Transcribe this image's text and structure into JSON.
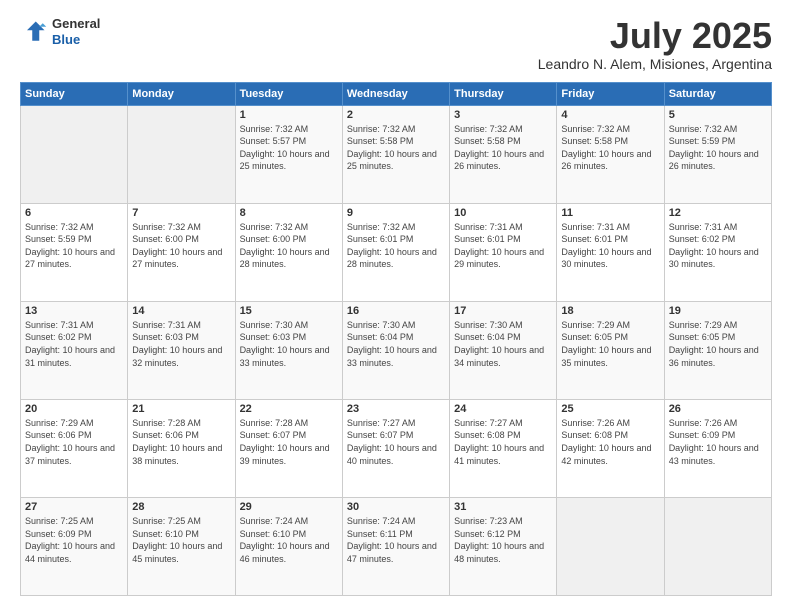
{
  "header": {
    "logo_line1": "General",
    "logo_line2": "Blue",
    "month": "July 2025",
    "location": "Leandro N. Alem, Misiones, Argentina"
  },
  "weekdays": [
    "Sunday",
    "Monday",
    "Tuesday",
    "Wednesday",
    "Thursday",
    "Friday",
    "Saturday"
  ],
  "weeks": [
    [
      {
        "day": "",
        "info": ""
      },
      {
        "day": "",
        "info": ""
      },
      {
        "day": "1",
        "info": "Sunrise: 7:32 AM\nSunset: 5:57 PM\nDaylight: 10 hours and 25 minutes."
      },
      {
        "day": "2",
        "info": "Sunrise: 7:32 AM\nSunset: 5:58 PM\nDaylight: 10 hours and 25 minutes."
      },
      {
        "day": "3",
        "info": "Sunrise: 7:32 AM\nSunset: 5:58 PM\nDaylight: 10 hours and 26 minutes."
      },
      {
        "day": "4",
        "info": "Sunrise: 7:32 AM\nSunset: 5:58 PM\nDaylight: 10 hours and 26 minutes."
      },
      {
        "day": "5",
        "info": "Sunrise: 7:32 AM\nSunset: 5:59 PM\nDaylight: 10 hours and 26 minutes."
      }
    ],
    [
      {
        "day": "6",
        "info": "Sunrise: 7:32 AM\nSunset: 5:59 PM\nDaylight: 10 hours and 27 minutes."
      },
      {
        "day": "7",
        "info": "Sunrise: 7:32 AM\nSunset: 6:00 PM\nDaylight: 10 hours and 27 minutes."
      },
      {
        "day": "8",
        "info": "Sunrise: 7:32 AM\nSunset: 6:00 PM\nDaylight: 10 hours and 28 minutes."
      },
      {
        "day": "9",
        "info": "Sunrise: 7:32 AM\nSunset: 6:01 PM\nDaylight: 10 hours and 28 minutes."
      },
      {
        "day": "10",
        "info": "Sunrise: 7:31 AM\nSunset: 6:01 PM\nDaylight: 10 hours and 29 minutes."
      },
      {
        "day": "11",
        "info": "Sunrise: 7:31 AM\nSunset: 6:01 PM\nDaylight: 10 hours and 30 minutes."
      },
      {
        "day": "12",
        "info": "Sunrise: 7:31 AM\nSunset: 6:02 PM\nDaylight: 10 hours and 30 minutes."
      }
    ],
    [
      {
        "day": "13",
        "info": "Sunrise: 7:31 AM\nSunset: 6:02 PM\nDaylight: 10 hours and 31 minutes."
      },
      {
        "day": "14",
        "info": "Sunrise: 7:31 AM\nSunset: 6:03 PM\nDaylight: 10 hours and 32 minutes."
      },
      {
        "day": "15",
        "info": "Sunrise: 7:30 AM\nSunset: 6:03 PM\nDaylight: 10 hours and 33 minutes."
      },
      {
        "day": "16",
        "info": "Sunrise: 7:30 AM\nSunset: 6:04 PM\nDaylight: 10 hours and 33 minutes."
      },
      {
        "day": "17",
        "info": "Sunrise: 7:30 AM\nSunset: 6:04 PM\nDaylight: 10 hours and 34 minutes."
      },
      {
        "day": "18",
        "info": "Sunrise: 7:29 AM\nSunset: 6:05 PM\nDaylight: 10 hours and 35 minutes."
      },
      {
        "day": "19",
        "info": "Sunrise: 7:29 AM\nSunset: 6:05 PM\nDaylight: 10 hours and 36 minutes."
      }
    ],
    [
      {
        "day": "20",
        "info": "Sunrise: 7:29 AM\nSunset: 6:06 PM\nDaylight: 10 hours and 37 minutes."
      },
      {
        "day": "21",
        "info": "Sunrise: 7:28 AM\nSunset: 6:06 PM\nDaylight: 10 hours and 38 minutes."
      },
      {
        "day": "22",
        "info": "Sunrise: 7:28 AM\nSunset: 6:07 PM\nDaylight: 10 hours and 39 minutes."
      },
      {
        "day": "23",
        "info": "Sunrise: 7:27 AM\nSunset: 6:07 PM\nDaylight: 10 hours and 40 minutes."
      },
      {
        "day": "24",
        "info": "Sunrise: 7:27 AM\nSunset: 6:08 PM\nDaylight: 10 hours and 41 minutes."
      },
      {
        "day": "25",
        "info": "Sunrise: 7:26 AM\nSunset: 6:08 PM\nDaylight: 10 hours and 42 minutes."
      },
      {
        "day": "26",
        "info": "Sunrise: 7:26 AM\nSunset: 6:09 PM\nDaylight: 10 hours and 43 minutes."
      }
    ],
    [
      {
        "day": "27",
        "info": "Sunrise: 7:25 AM\nSunset: 6:09 PM\nDaylight: 10 hours and 44 minutes."
      },
      {
        "day": "28",
        "info": "Sunrise: 7:25 AM\nSunset: 6:10 PM\nDaylight: 10 hours and 45 minutes."
      },
      {
        "day": "29",
        "info": "Sunrise: 7:24 AM\nSunset: 6:10 PM\nDaylight: 10 hours and 46 minutes."
      },
      {
        "day": "30",
        "info": "Sunrise: 7:24 AM\nSunset: 6:11 PM\nDaylight: 10 hours and 47 minutes."
      },
      {
        "day": "31",
        "info": "Sunrise: 7:23 AM\nSunset: 6:12 PM\nDaylight: 10 hours and 48 minutes."
      },
      {
        "day": "",
        "info": ""
      },
      {
        "day": "",
        "info": ""
      }
    ]
  ]
}
